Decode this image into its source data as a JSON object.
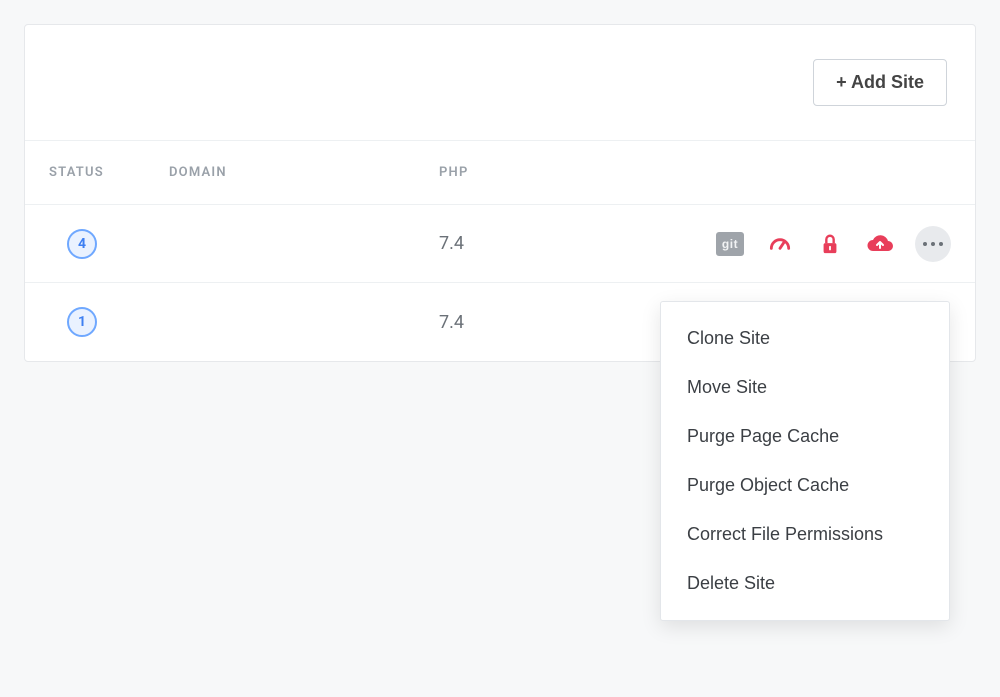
{
  "header": {
    "add_site_label": "+ Add Site"
  },
  "columns": {
    "status": "STATUS",
    "domain": "DOMAIN",
    "php": "PHP"
  },
  "rows": [
    {
      "status_badge": "4",
      "domain": "",
      "php": "7.4"
    },
    {
      "status_badge": "1",
      "domain": "",
      "php": "7.4"
    }
  ],
  "action_icons": {
    "git": "git",
    "speed": "speed-icon",
    "lock": "lock-icon",
    "cloud": "cloud-upload-icon",
    "more": "more-icon"
  },
  "dropdown": {
    "items": [
      "Clone Site",
      "Move Site",
      "Purge Page Cache",
      "Purge Object Cache",
      "Correct File Permissions",
      "Delete Site"
    ]
  },
  "colors": {
    "accent_pink": "#e83e5a",
    "badge_blue": "#3d7ff2"
  }
}
